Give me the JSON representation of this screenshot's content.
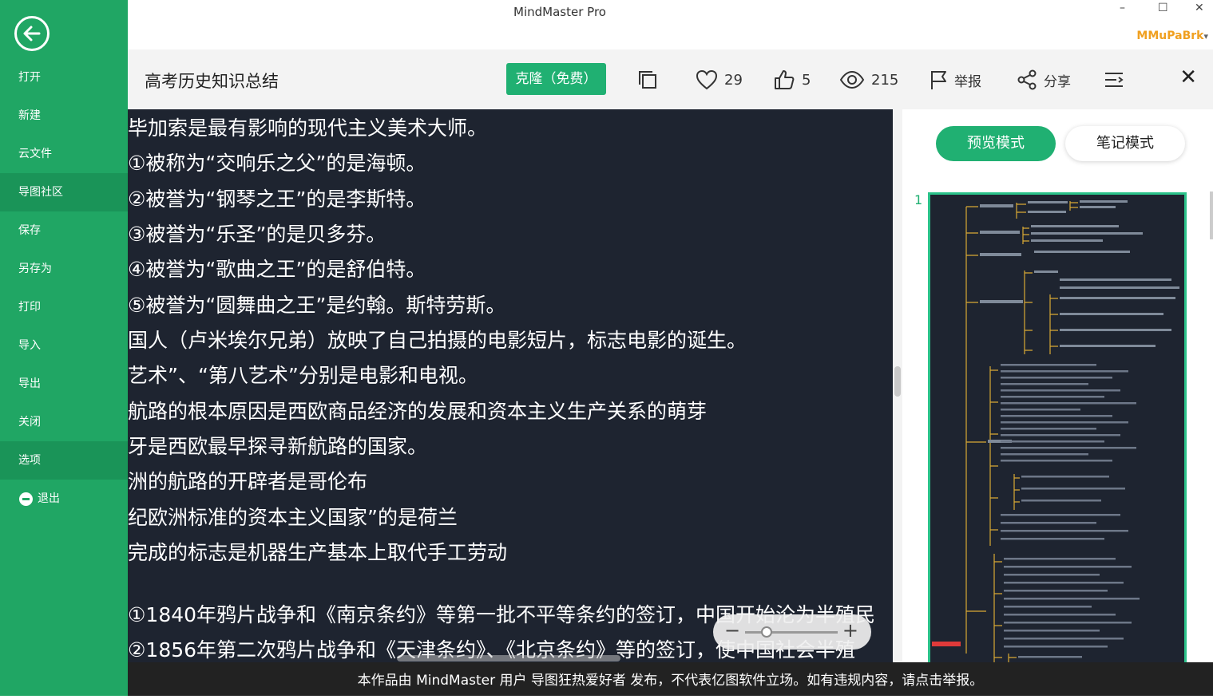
{
  "window": {
    "title": "MindMaster Pro",
    "minimize": "–",
    "maximize": "☐",
    "close": "✕",
    "brand": "MMuPaBrk",
    "brand_arrow": "▾"
  },
  "sidebar": {
    "back_icon": "back-arrow-icon",
    "items": [
      {
        "label": "打开"
      },
      {
        "label": "新建"
      },
      {
        "label": "云文件"
      },
      {
        "label": "导图社区"
      },
      {
        "label": "保存"
      },
      {
        "label": "另存为"
      },
      {
        "label": "打印"
      },
      {
        "label": "导入"
      },
      {
        "label": "导出"
      },
      {
        "label": "关闭"
      },
      {
        "label": "选项"
      },
      {
        "label": "退出"
      }
    ]
  },
  "header": {
    "doc_title": "高考历史知识总结",
    "clone_label": "克隆（免费）",
    "like_count": "29",
    "thumb_count": "5",
    "view_count": "215",
    "report_label": "举报",
    "share_label": "分享",
    "close": "✕"
  },
  "content": {
    "lines": [
      "毕加索是最有影响的现代主义美术大师。",
      " ①被称为“交响乐之父”的是海顿。",
      " ②被誉为“钢琴之王”的是李斯特。",
      " ③被誉为“乐圣”的是贝多芬。",
      " ④被誉为“歌曲之王”的是舒伯特。",
      " ⑤被誉为“圆舞曲之王”是约翰。斯特劳斯。",
      "国人（卢米埃尔兄弟）放映了自己拍摄的电影短片，标志电影的诞生。",
      "艺术”、“第八艺术”分别是电影和电视。",
      "航路的根本原因是西欧商品经济的发展和资本主义生产关系的萌芽",
      "牙是西欧最早探寻新航路的国家。",
      "洲的航路的开辟者是哥伦布",
      "纪欧洲标准的资本主义国家”的是荷兰",
      "完成的标志是机器生产基本上取代手工劳动",
      "①1840年鸦片战争和《南京条约》等第一批不平等条约的签订，中国开始沦为半殖民",
      "②1856年第二次鸦片战争和《天津条约》、《北京条约》等的签订，使中国社会半殖"
    ],
    "zoom_minus": "−",
    "zoom_plus": "+"
  },
  "right_panel": {
    "preview_mode": "预览模式",
    "note_mode": "笔记模式",
    "page_number": "1"
  },
  "footer": {
    "notice": "本作品由 MindMaster 用户 导图狂热爱好者 发布，不代表亿图软件立场。如有违规内容，请点击举报。"
  },
  "colors": {
    "sidebar": "#20a664",
    "accent": "#20b072",
    "canvas": "#1e2430",
    "brand": "#f0a020"
  }
}
